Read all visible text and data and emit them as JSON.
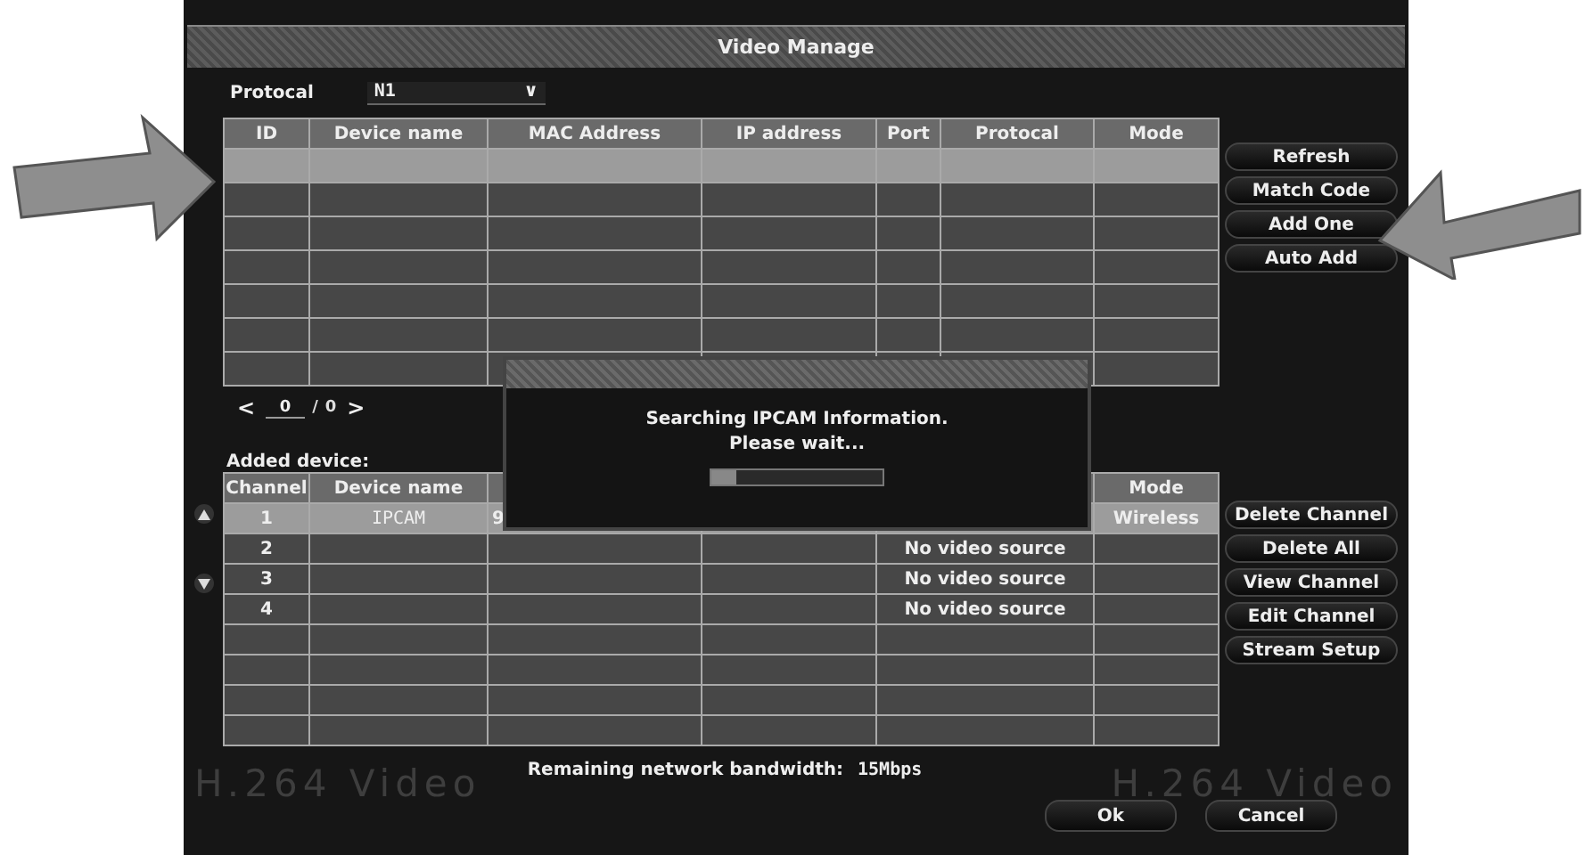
{
  "window": {
    "title": "Video Manage"
  },
  "protocol_filter": {
    "label": "Protocal",
    "value": "N1",
    "caret": "∨"
  },
  "search_table": {
    "columns": [
      "ID",
      "Device name",
      "MAC Address",
      "IP address",
      "Port",
      "Protocal",
      "Mode"
    ],
    "rows": [
      {
        "selected": true
      },
      {
        "selected": false
      },
      {
        "selected": false
      },
      {
        "selected": false
      },
      {
        "selected": false
      },
      {
        "selected": false
      },
      {
        "selected": false
      }
    ]
  },
  "pager": {
    "prev": "<",
    "page": "0",
    "separator": "/",
    "total": "0",
    "next": ">"
  },
  "search_buttons": [
    "Refresh",
    "Match Code",
    "Add One",
    "Auto Add"
  ],
  "added_device": {
    "label": "Added device:",
    "columns": [
      "Channel",
      "Device name",
      "Mode"
    ],
    "rows": [
      {
        "channel": "1",
        "device_name": "IPCAM",
        "column_3": "9",
        "status": "",
        "mode": "Wireless",
        "selected": true
      },
      {
        "channel": "2",
        "device_name": "",
        "column_3": "",
        "status": "No video source",
        "mode": "",
        "selected": false
      },
      {
        "channel": "3",
        "device_name": "",
        "column_3": "",
        "status": "No video source",
        "mode": "",
        "selected": false
      },
      {
        "channel": "4",
        "device_name": "",
        "column_3": "",
        "status": "No video source",
        "mode": "",
        "selected": false
      },
      {
        "channel": "",
        "device_name": "",
        "column_3": "",
        "status": "",
        "mode": "",
        "selected": false
      },
      {
        "channel": "",
        "device_name": "",
        "column_3": "",
        "status": "",
        "mode": "",
        "selected": false
      },
      {
        "channel": "",
        "device_name": "",
        "column_3": "",
        "status": "",
        "mode": "",
        "selected": false
      },
      {
        "channel": "",
        "device_name": "",
        "column_3": "",
        "status": "",
        "mode": "",
        "selected": false
      }
    ]
  },
  "channel_buttons": [
    "Delete Channel",
    "Delete All",
    "View Channel",
    "Edit Channel",
    "Stream Setup"
  ],
  "bandwidth": {
    "label": "Remaining network bandwidth:",
    "value": "15Mbps"
  },
  "background_marks": [
    "H.264 Video",
    "H.264 Video"
  ],
  "dialog": {
    "lines": [
      "Searching IPCAM Information.",
      "Please wait..."
    ],
    "level": 0.15
  },
  "footer_buttons": [
    "Ok",
    "Cancel"
  ]
}
